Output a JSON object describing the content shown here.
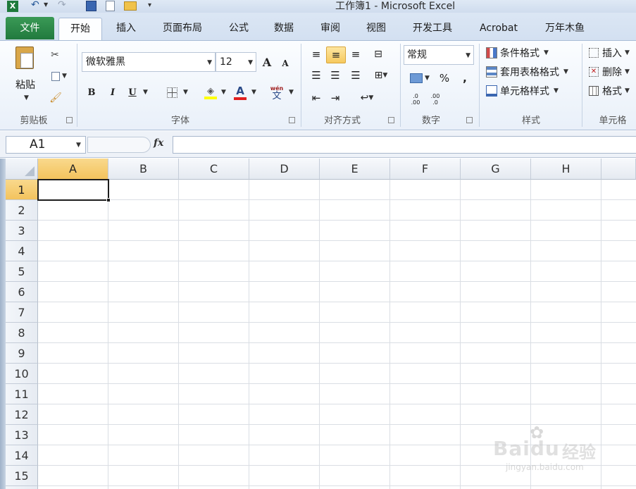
{
  "window": {
    "title": "工作簿1 - Microsoft Excel"
  },
  "tabs": [
    "文件",
    "开始",
    "插入",
    "页面布局",
    "公式",
    "数据",
    "审阅",
    "视图",
    "开发工具",
    "Acrobat",
    "万年木鱼"
  ],
  "clipboard": {
    "paste": "粘贴",
    "group": "剪贴板"
  },
  "font": {
    "name": "微软雅黑",
    "size": "12",
    "bold": "B",
    "italic": "I",
    "underline": "U",
    "color_letter": "A",
    "phonetic": "wén",
    "group": "字体"
  },
  "alignment": {
    "group": "对齐方式"
  },
  "number": {
    "format": "常规",
    "percent": "%",
    "comma": ",",
    "group": "数字"
  },
  "styles": {
    "conditional": "条件格式",
    "table": "套用表格格式",
    "cell": "单元格样式",
    "group": "样式"
  },
  "cells": {
    "insert": "插入",
    "delete": "删除",
    "format": "格式",
    "group": "单元格"
  },
  "formula": {
    "namebox": "A1",
    "fx": "fx",
    "value": ""
  },
  "columns": [
    "A",
    "B",
    "C",
    "D",
    "E",
    "F",
    "G",
    "H"
  ],
  "rows": [
    "1",
    "2",
    "3",
    "4",
    "5",
    "6",
    "7",
    "8",
    "9",
    "10",
    "11",
    "12",
    "13",
    "14",
    "15"
  ],
  "watermark": {
    "brand": "Baidu",
    "label": "经验",
    "url": "jingyan.baidu.com"
  },
  "colors": {
    "file_tab": "#217a3e",
    "selection_header": "#f3c35d",
    "font_color_bar": "#e02020",
    "highlight_bar": "#ffff00"
  }
}
